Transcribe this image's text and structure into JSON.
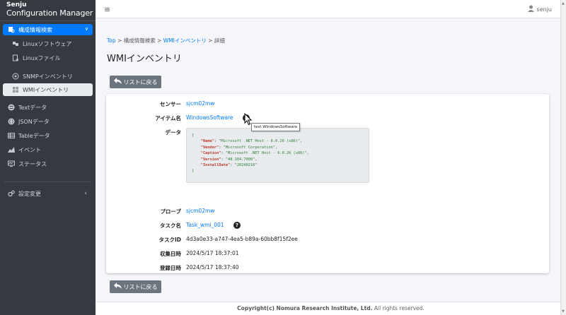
{
  "brand": {
    "line1": "Senju",
    "line2": "Configuration Manager"
  },
  "sidebar": {
    "items": [
      {
        "label": "構成情報検索",
        "icon": "search-db-icon"
      },
      {
        "label": "Linuxソフトウェア",
        "icon": "cubes-icon"
      },
      {
        "label": "Linuxファイル",
        "icon": "file-icon"
      },
      {
        "label": "SNMPインベントリ",
        "icon": "network-icon"
      },
      {
        "label": "WMIインベントリ",
        "icon": "windows-icon"
      },
      {
        "label": "Textデータ",
        "icon": "list-icon"
      },
      {
        "label": "JSONデータ",
        "icon": "braces-icon"
      },
      {
        "label": "Tableデータ",
        "icon": "table-icon"
      },
      {
        "label": "イベント",
        "icon": "chart-icon"
      },
      {
        "label": "ステータス",
        "icon": "monitor-icon"
      },
      {
        "label": "設定変更",
        "icon": "gears-icon"
      }
    ]
  },
  "topbar": {
    "user": "senju"
  },
  "breadcrumb": {
    "top": "Top",
    "sep1": " > 構成情報検索 > ",
    "wmi": "WMIインベントリ",
    "sep2": " > 詳細"
  },
  "page": {
    "title": "WMIインベントリ",
    "back_label": "リストに戻る"
  },
  "detail": {
    "sensor_label": "センサー",
    "sensor_value": "sjcm02mw",
    "item_label": "アイテム名",
    "item_value": "WindowsSoftware",
    "data_label": "データ",
    "data": {
      "open": "{",
      "lines": [
        {
          "k": "\"Name\"",
          "v": "\"Microsoft .NET Host - 6.0.26 (x86)\","
        },
        {
          "k": "\"Vendor\"",
          "v": "\"Microsoft Corporation\","
        },
        {
          "k": "\"Caption\"",
          "v": "\"Microsoft .NET Host - 6.0.26 (x86)\","
        },
        {
          "k": "\"Version\"",
          "v": "\"48.104.7000\","
        },
        {
          "k": "\"InstallDate\"",
          "v": "\"20240216\""
        }
      ],
      "close": "}"
    },
    "probe_label": "プローブ",
    "probe_value": "sjcm02mw",
    "task_label": "タスク名",
    "task_value": "Task_wmi_001",
    "taskid_label": "タスクID",
    "taskid_value": "4d3a0e33-a747-4ea5-b89a-60bb8f15f2ee",
    "collected_label": "収集日時",
    "collected_value": "2024/5/17 18:37:01",
    "registered_label": "登録日時",
    "registered_value": "2024/5/17 18:37:40"
  },
  "tooltip": "test WindowsSoftware",
  "footer": {
    "copyright": "Copyright(c) Nomura Research Institute, Ltd.",
    "rights": " All rights reserved."
  }
}
